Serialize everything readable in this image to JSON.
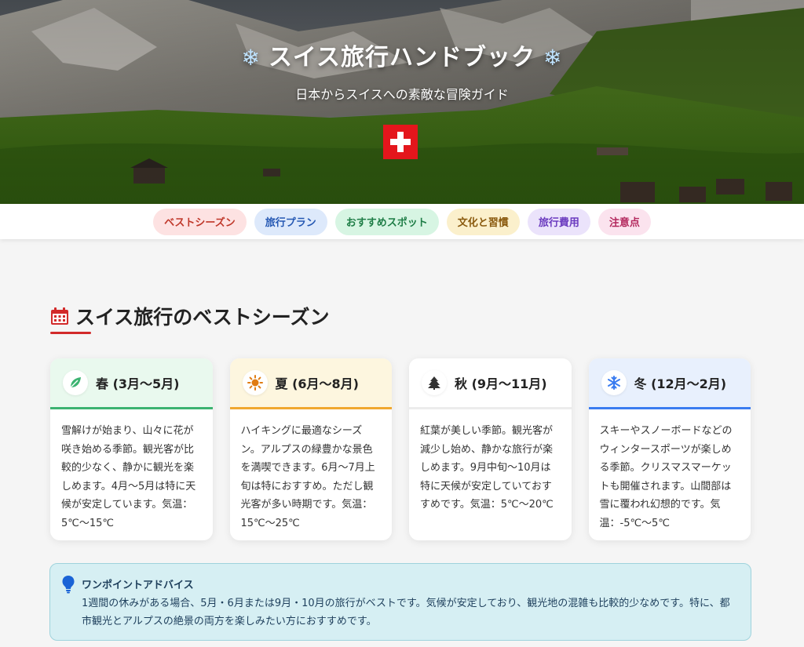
{
  "hero": {
    "title": "スイス旅行ハンドブック",
    "snow_left": "❄",
    "snow_right": "❄",
    "subtitle": "日本からスイスへの素敵な冒険ガイド",
    "flag_icon": "swiss-flag-icon"
  },
  "nav": {
    "items": [
      {
        "label": "ベストシーズン"
      },
      {
        "label": "旅行プラン"
      },
      {
        "label": "おすすめスポット"
      },
      {
        "label": "文化と習慣"
      },
      {
        "label": "旅行費用"
      },
      {
        "label": "注意点"
      }
    ]
  },
  "section": {
    "title": "スイス旅行のベストシーズン",
    "icon": "calendar-icon",
    "accent": "#d22a2a"
  },
  "seasons": [
    {
      "icon": "leaf-icon",
      "name": "春 (3月〜5月)",
      "text": "雪解けが始まり、山々に花が咲き始める季節。観光客が比較的少なく、静かに観光を楽しめます。4月〜5月は特に天候が安定しています。気温：5℃〜15℃",
      "color": "#3cb371"
    },
    {
      "icon": "sun-icon",
      "name": "夏 (6月〜8月)",
      "text": "ハイキングに最適なシーズン。アルプスの緑豊かな景色を満喫できます。6月〜7月上旬は特におすすめ。ただし観光客が多い時期です。気温：15℃〜25℃",
      "color": "#f0a830"
    },
    {
      "icon": "tree-icon",
      "name": "秋 (9月〜11月)",
      "text": "紅葉が美しい季節。観光客が減少し始め、静かな旅行が楽しめます。9月中旬〜10月は特に天候が安定していておすすめです。気温：5℃〜20℃",
      "color": "#333333"
    },
    {
      "icon": "snowflake-icon",
      "name": "冬 (12月〜2月)",
      "text": "スキーやスノーボードなどのウィンタースポーツが楽しめる季節。クリスマスマーケットも開催されます。山間部は雪に覆われ幻想的です。気温：-5℃〜5℃",
      "color": "#3a7cf0"
    }
  ],
  "tip": {
    "icon": "lightbulb-icon",
    "title": "ワンポイントアドバイス",
    "text": "1週間の休みがある場合、5月・6月または9月・10月の旅行がベストです。気候が安定しており、観光地の混雑も比較的少なめです。特に、都市観光とアルプスの絶景の両方を楽しみたい方におすすめです。"
  }
}
